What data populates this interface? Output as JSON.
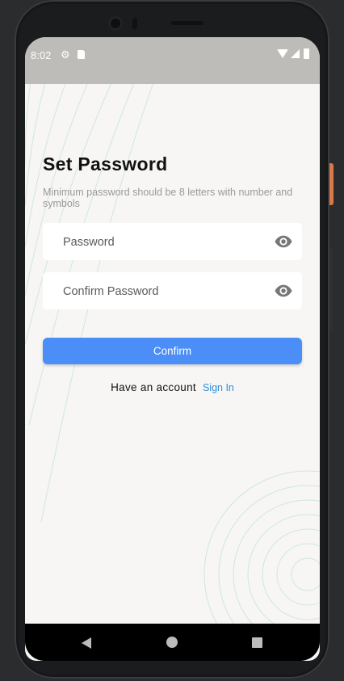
{
  "status_bar": {
    "time": "8:02"
  },
  "page": {
    "title": "Set Password",
    "subtitle": "Minimum password should be 8 letters with number and symbols"
  },
  "form": {
    "password_placeholder": "Password",
    "confirm_password_placeholder": "Confirm Password",
    "confirm_label": "Confirm"
  },
  "footer": {
    "have_account_label": "Have an account",
    "sign_in_label": "Sign In"
  },
  "colors": {
    "primary": "#4b8ef8",
    "link": "#2f8ede",
    "background": "#f7f6f4",
    "status_bar": "#bdbcb9"
  },
  "icons": [
    "settings-icon",
    "sd-card-icon",
    "wifi-icon",
    "cell-signal-icon",
    "battery-icon",
    "eye-icon",
    "back-icon",
    "home-icon",
    "recent-apps-icon"
  ]
}
